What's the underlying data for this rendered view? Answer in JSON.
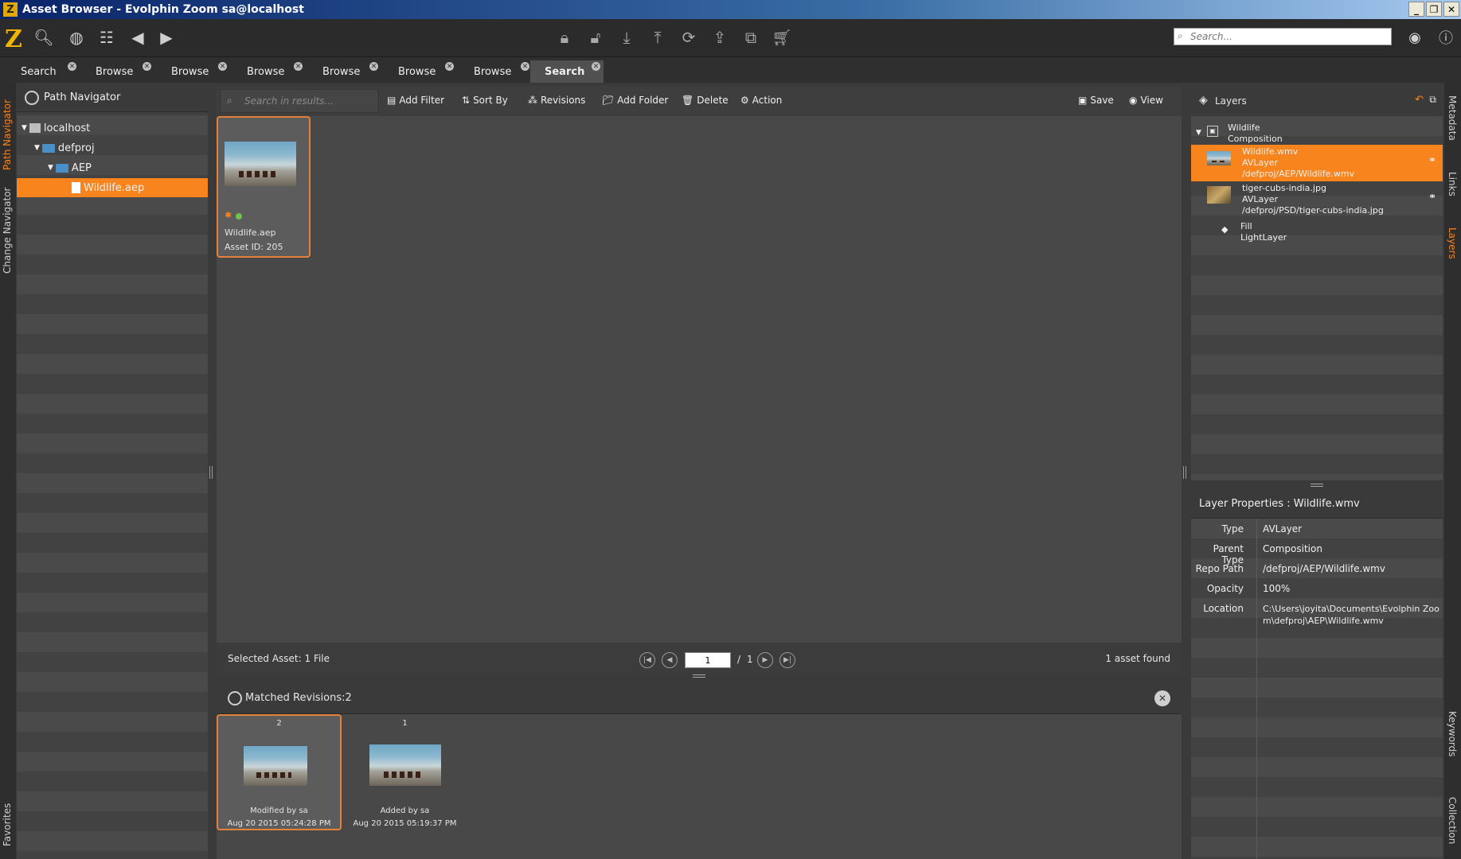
{
  "window": {
    "title": "Asset Browser - Evolphin Zoom sa@localhost",
    "logo_letter": "Z"
  },
  "toolbar": {
    "search_placeholder": "Search..."
  },
  "tabs": [
    {
      "label": "Search"
    },
    {
      "label": "Browse"
    },
    {
      "label": "Browse"
    },
    {
      "label": "Browse"
    },
    {
      "label": "Browse"
    },
    {
      "label": "Browse"
    },
    {
      "label": "Browse"
    },
    {
      "label": "Search"
    }
  ],
  "left_strip": {
    "path_navigator": "Path Navigator",
    "change_navigator": "Change Navigator",
    "favorites": "Favorites"
  },
  "right_strip": {
    "metadata": "Metadata",
    "links": "Links",
    "layers": "Layers",
    "keywords": "Keywords",
    "collection": "Collection"
  },
  "path_navigator": {
    "title": "Path Navigator",
    "tree": [
      {
        "label": "localhost"
      },
      {
        "label": "defproj"
      },
      {
        "label": "AEP"
      },
      {
        "label": "Wildlife.aep"
      }
    ]
  },
  "results_toolbar": {
    "search_placeholder": "Search in results...",
    "add_filter": "Add Filter",
    "sort_by": "Sort By",
    "revisions": "Revisions",
    "add_folder": "Add Folder",
    "delete": "Delete",
    "action": "Action",
    "save": "Save",
    "view": "View"
  },
  "asset_card": {
    "name": "Wildlife.aep",
    "asset_id": "Asset ID: 205"
  },
  "status": {
    "selected": "Selected Asset: 1 File",
    "page": "1",
    "page_sep": "/",
    "total_pages": "1",
    "found": "1 asset found"
  },
  "revisions": {
    "title": "Matched Revisions:2",
    "items": [
      {
        "number": "2",
        "line1": "Modified by sa",
        "line2": "Aug 20 2015 05:24:28 PM"
      },
      {
        "number": "1",
        "line1": "Added by sa",
        "line2": "Aug 20 2015 05:19:37 PM"
      }
    ]
  },
  "layers": {
    "title": "Layers",
    "root": {
      "name": "Wildlife",
      "type": "Composition"
    },
    "items": [
      {
        "name": "Wildlife.wmv",
        "type": "AVLayer",
        "path": "/defproj/AEP/Wildlife.wmv"
      },
      {
        "name": "tiger-cubs-india.jpg",
        "type": "AVLayer",
        "path": "/defproj/PSD/tiger-cubs-india.jpg"
      },
      {
        "name": "Fill",
        "type": "LightLayer"
      }
    ]
  },
  "layer_properties": {
    "title": "Layer Properties : Wildlife.wmv",
    "rows": [
      {
        "label": "Type",
        "value": "AVLayer"
      },
      {
        "label": "Parent Type",
        "value": "Composition"
      },
      {
        "label": "Repo Path",
        "value": "/defproj/AEP/Wildlife.wmv"
      },
      {
        "label": "Opacity",
        "value": "100%"
      },
      {
        "label": "Location",
        "value": "C:\\Users\\joyita\\Documents\\Evolphin Zoom\\defproj\\AEP\\Wildlife.wmv"
      }
    ]
  },
  "colors": {
    "accent": "#f7841c",
    "panel": "#404040",
    "toolbar": "#2b2b2b"
  }
}
